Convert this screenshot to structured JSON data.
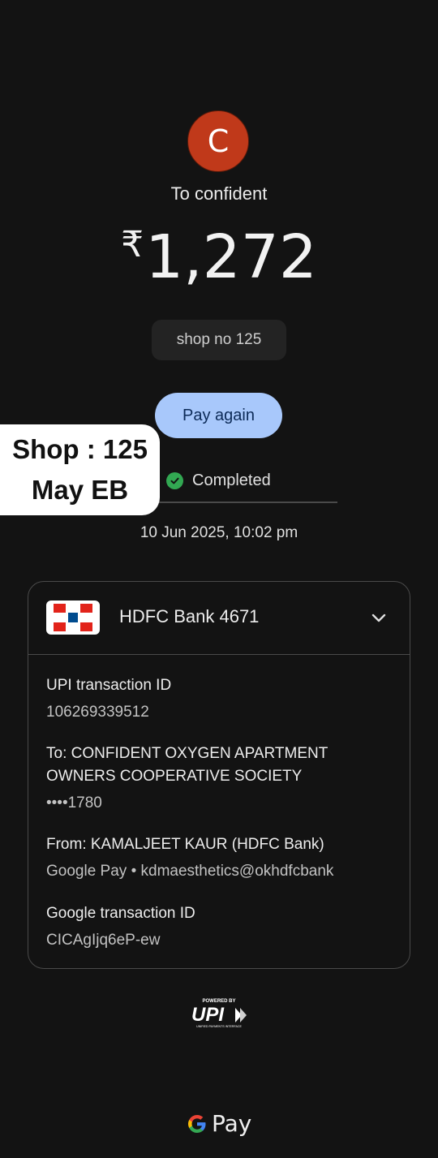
{
  "payee": {
    "avatar_letter": "C",
    "to_line": "To confident",
    "currency_symbol": "₹",
    "amount": "1,272",
    "note": "shop no 125"
  },
  "actions": {
    "pay_again_label": "Pay again"
  },
  "status": {
    "label": "Completed",
    "icon": "check-circle-icon",
    "color": "#32a852"
  },
  "datetime": "10 Jun 2025, 10:02 pm",
  "sticker": {
    "line1": "Shop : 125",
    "line2": "May EB"
  },
  "details_card": {
    "bank_account": "HDFC Bank 4671",
    "bank_logo": "hdfc-bank-logo",
    "expand_icon": "chevron-down-icon",
    "upi_id_label": "UPI transaction ID",
    "upi_id_value": "106269339512",
    "to_label": "To: CONFIDENT OXYGEN APARTMENT OWNERS COOPERATIVE SOCIETY",
    "to_account": "••••1780",
    "from_label": "From: KAMALJEET KAUR (HDFC Bank)",
    "from_value": "Google Pay • kdmaesthetics@okhdfcbank",
    "google_id_label": "Google transaction ID",
    "google_id_value": "CICAgIjq6eP-ew"
  },
  "footer": {
    "upi_powered_by": "POWERED BY",
    "upi_text": "UPI",
    "upi_tagline": "UNIFIED PAYMENTS INTERFACE",
    "gpay_text": "Pay"
  },
  "colors": {
    "background": "#131313",
    "accent_button": "#a8c8fb",
    "avatar": "#c0391a",
    "hdfc_red": "#e2231a",
    "hdfc_blue": "#004c8f"
  }
}
